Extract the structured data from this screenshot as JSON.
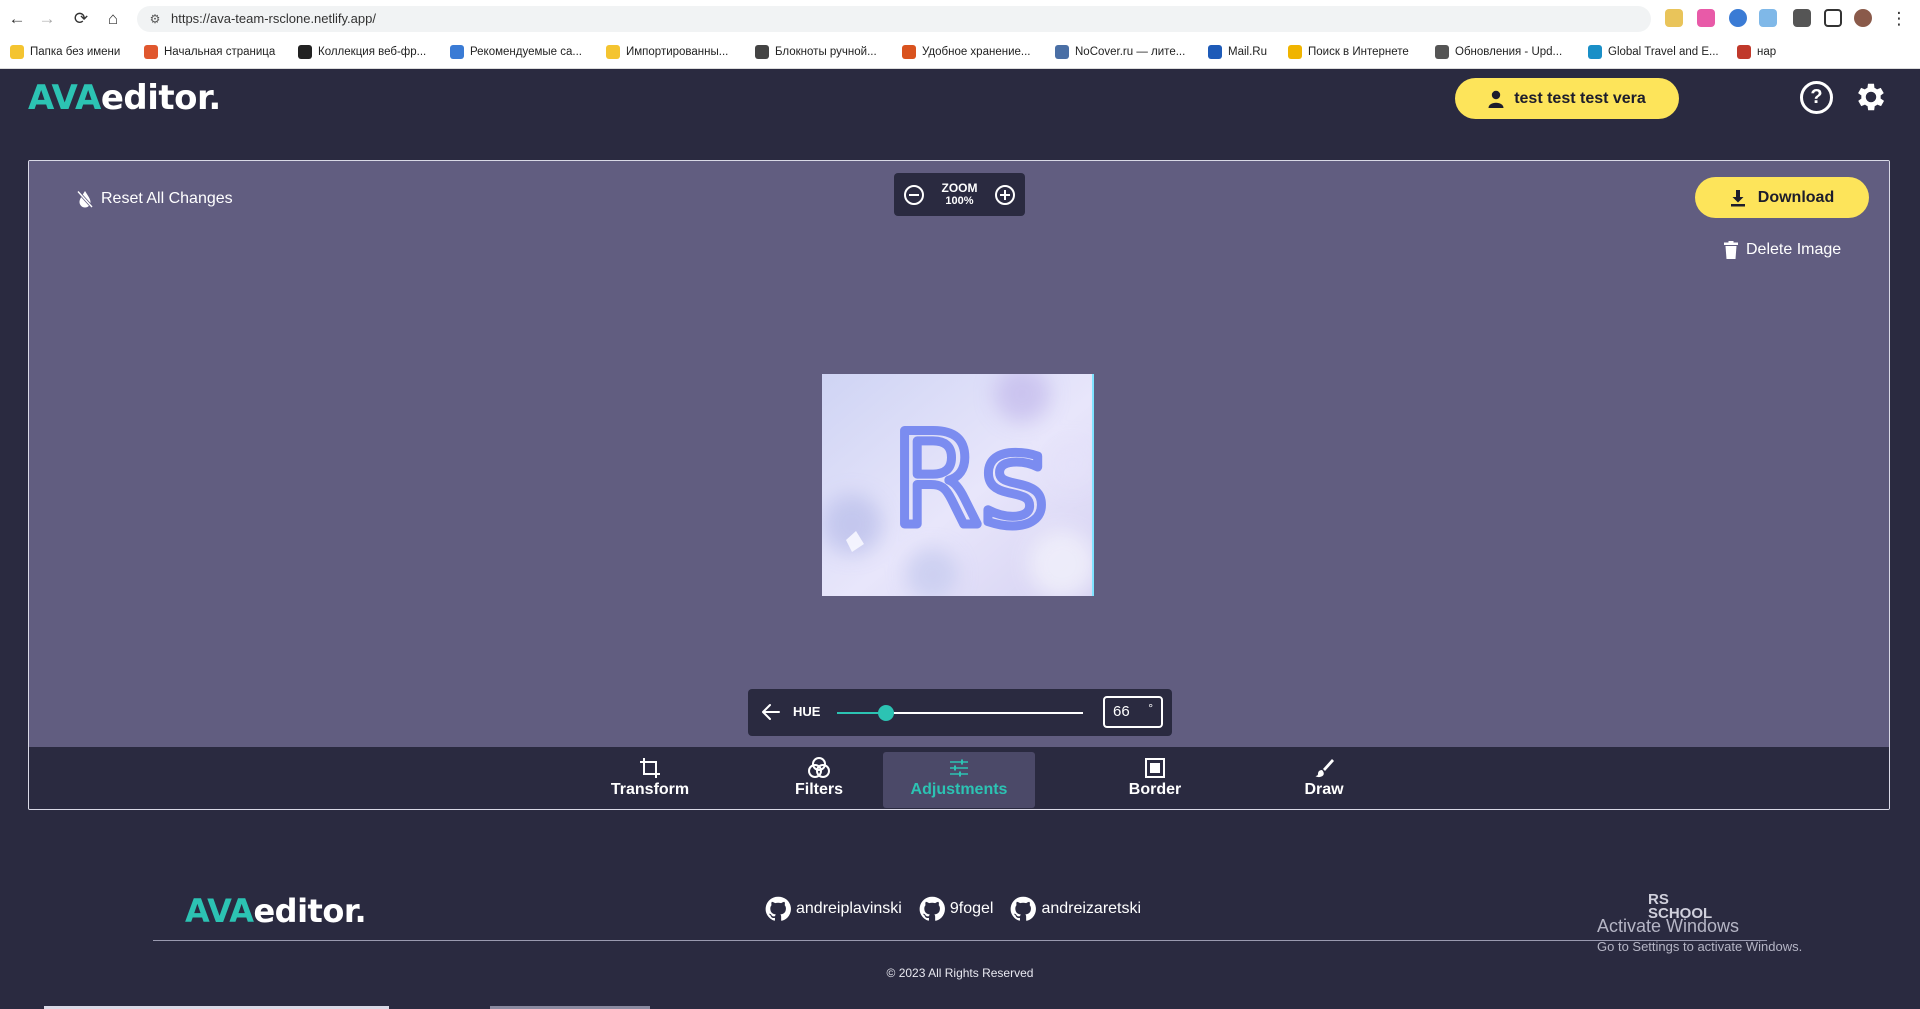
{
  "browser": {
    "url": "https://ava-team-rsclone.netlify.app/",
    "bookmarks": [
      {
        "label": "Папка без имени",
        "color": "#f4c430"
      },
      {
        "label": "Начальная страница",
        "color": "#e0572e"
      },
      {
        "label": "Коллекция веб-фр...",
        "color": "#222222"
      },
      {
        "label": "Рекомендуемые са...",
        "color": "#3a7bd5"
      },
      {
        "label": "Импортированны...",
        "color": "#f4c430"
      },
      {
        "label": "Блокноты ручной...",
        "color": "#444444"
      },
      {
        "label": "Удобное хранение...",
        "color": "#d9531e"
      },
      {
        "label": "NoCover.ru — лите...",
        "color": "#4a6fa5"
      },
      {
        "label": "Mail.Ru",
        "color": "#1e5bb8"
      },
      {
        "label": "Поиск в Интернете",
        "color": "#f0b400"
      },
      {
        "label": "Обновления - Upd...",
        "color": "#555555"
      },
      {
        "label": "Global Travel and E...",
        "color": "#1a8fc7"
      },
      {
        "label": "нар",
        "color": "#c0392b"
      }
    ]
  },
  "header": {
    "logo_accent": "AVA",
    "logo_rest": "editor.",
    "user_label": "test test test vera",
    "help_label": "?"
  },
  "toolbar": {
    "reset_label": "Reset All Changes",
    "zoom_label": "ZOOM",
    "zoom_value": "100%",
    "download_label": "Download",
    "delete_label": "Delete Image"
  },
  "image": {
    "text": "Rs"
  },
  "adjustment": {
    "label": "HUE",
    "value": "66",
    "unit": "°",
    "fraction": 0.2
  },
  "tabs": [
    {
      "label": "Transform",
      "icon": "crop-icon",
      "active": false
    },
    {
      "label": "Filters",
      "icon": "filters-icon",
      "active": false
    },
    {
      "label": "Adjustments",
      "icon": "sliders-icon",
      "active": true
    },
    {
      "label": "Border",
      "icon": "border-icon",
      "active": false
    },
    {
      "label": "Draw",
      "icon": "brush-icon",
      "active": false
    }
  ],
  "footer": {
    "logo_accent": "AVA",
    "logo_rest": "editor.",
    "authors": [
      "andreiplavinski",
      "9fogel",
      "andreizaretski"
    ],
    "copyright": "© 2023 All Rights Reserved",
    "school_line1": "RS",
    "school_line2": "SCHOOL",
    "win_title": "Activate Windows",
    "win_sub": "Go to Settings to activate Windows."
  },
  "colors": {
    "accent": "#2cc3b3",
    "button": "#fde45a",
    "canvas": "#615d80",
    "background": "#2a2a40"
  }
}
